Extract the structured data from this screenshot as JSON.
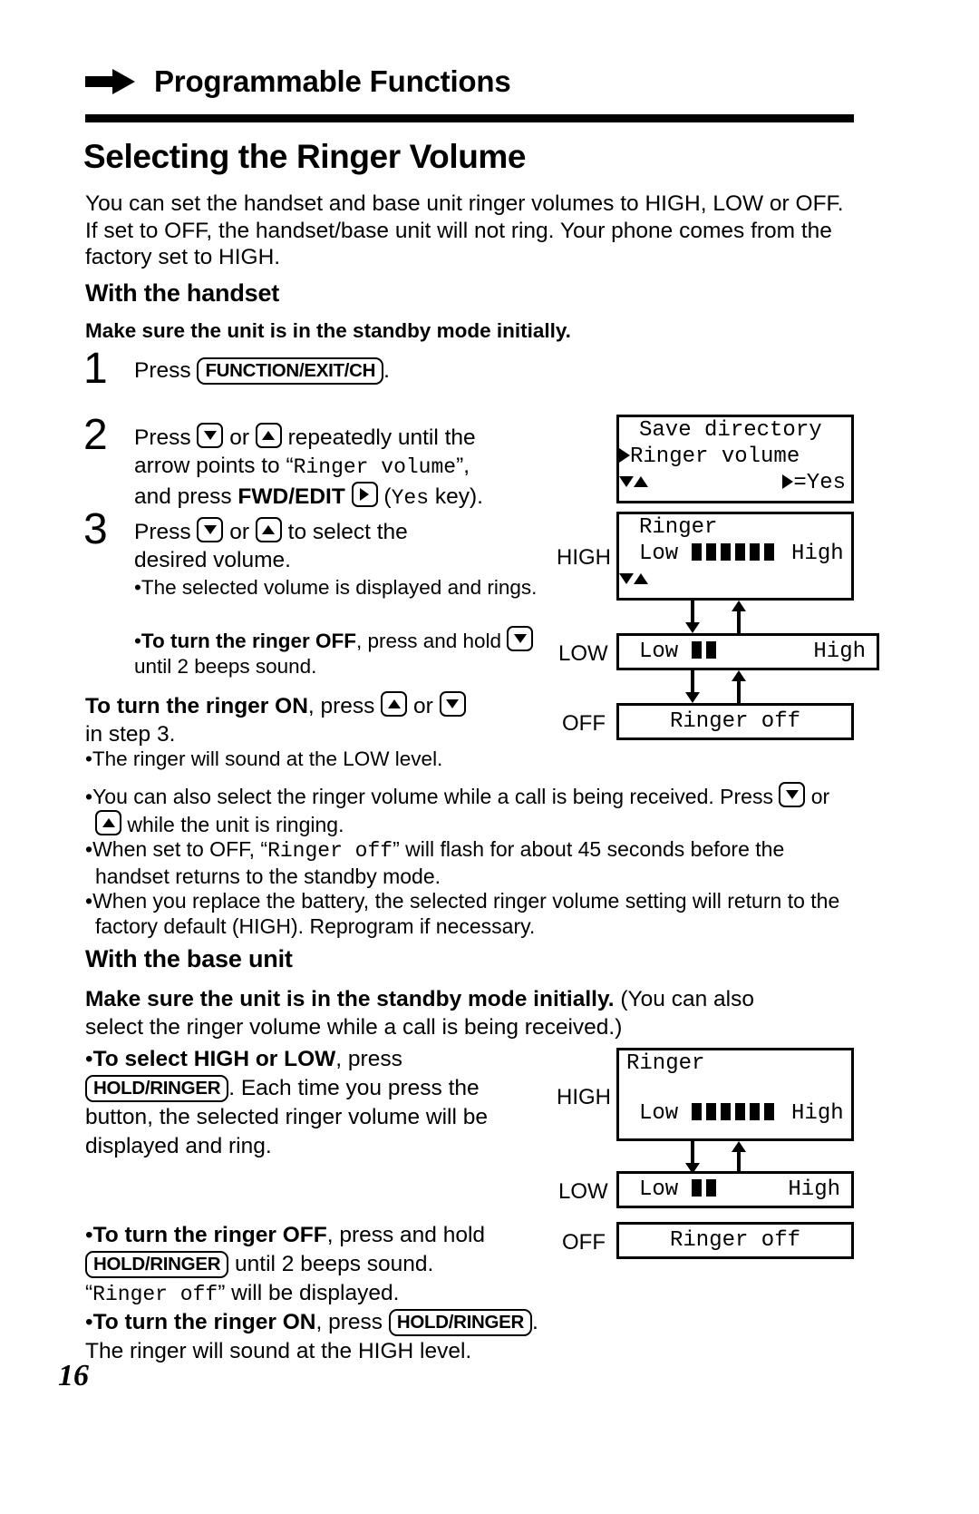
{
  "header": {
    "icon": "right-arrow-icon",
    "title": "Programmable Functions"
  },
  "doc_title": "Selecting the Ringer Volume",
  "intro": "You can set the handset and base unit ringer volumes to HIGH, LOW or OFF. If set to OFF, the handset/base unit will not ring. Your phone comes from the factory set to HIGH.",
  "handset": {
    "section_title": "With the handset",
    "standby_note": "Make sure the unit is in the standby mode initially.",
    "steps": [
      {
        "num": "1",
        "pre": "Press ",
        "key": "FUNCTION/EXIT/CH",
        "post": "."
      },
      {
        "num": "2",
        "line1_a": "Press ",
        "line1_b": " or ",
        "line1_c": " repeatedly until the",
        "line2_a": "arrow points to “",
        "line2_mono": "Ringer volume",
        "line2_b": "”,",
        "line3_a": "and press ",
        "line3_bold": "FWD/EDIT",
        "line3_b": " (",
        "line3_mono": "Yes",
        "line3_c": " key)."
      },
      {
        "num": "3",
        "line1_a": "Press ",
        "line1_b": " or ",
        "line1_c": " to select the",
        "line2": "desired volume."
      }
    ],
    "sub_bullets": [
      {
        "text": "The selected volume is displayed and rings."
      },
      {
        "bold": "To turn the ringer OFF",
        "rest_a": ", press and hold ",
        "rest_b": " until 2 beeps sound."
      }
    ],
    "turn_on": {
      "bold": "To turn the ringer ON",
      "mid": ", press ",
      "or": " or ",
      "tail": "in step 3."
    },
    "turn_on_note": "The ringer will sound at the LOW level."
  },
  "notes": [
    {
      "a": "You can also select the ringer volume while a call is being received. Press ",
      "b": " or ",
      "c": " while the unit is ringing."
    },
    {
      "a": "When set to OFF, “",
      "mono": "Ringer off",
      "c": "” will flash for about 45 seconds before the handset returns to the standby mode."
    },
    {
      "a": "When you replace the battery, the selected ringer volume setting will return to the factory default (HIGH). Reprogram if necessary."
    }
  ],
  "base_unit": {
    "section_title": "With the base unit",
    "lead_bold": "Make sure the unit is in the standby mode initially.",
    "lead_rest": " (You can also select the ringer volume while a call is being received.)",
    "bullets": [
      {
        "bold": "To select HIGH or LOW",
        "mid": ", press ",
        "key": "HOLD/RINGER",
        "rest": ". Each time you press the button, the selected ringer volume will be displayed and ring."
      },
      {
        "bold": "To turn the ringer OFF",
        "mid": ", press and hold ",
        "key": "HOLD/RINGER",
        "rest": " until 2 beeps sound.",
        "sub_mono": "Ringer off",
        "sub_rest": "” will be displayed.",
        "sub_lead": "“"
      },
      {
        "bold": "To turn the ringer ON",
        "mid": ", press ",
        "key": "HOLD/RINGER",
        "rest": ".",
        "sub": "The ringer will sound at the HIGH level."
      }
    ]
  },
  "lcd_handset": {
    "menu": {
      "line1": "Save directory",
      "line2_text": "Ringer volume",
      "line3_right": "=Yes"
    },
    "high": {
      "label": "HIGH",
      "line1": "Ringer",
      "low_label": "Low",
      "high_label": "High",
      "bars": 6
    },
    "low": {
      "label": "LOW",
      "low_label": "Low",
      "high_label": "High",
      "bars": 2
    },
    "off": {
      "label": "OFF",
      "text": "Ringer off"
    }
  },
  "lcd_base": {
    "high": {
      "label": "HIGH",
      "line1": "Ringer",
      "low_label": "Low",
      "high_label": "High",
      "bars": 6
    },
    "low": {
      "label": "LOW",
      "low_label": "Low",
      "high_label": "High",
      "bars": 2
    },
    "off": {
      "label": "OFF",
      "text": "Ringer off"
    }
  },
  "page_number": "16"
}
